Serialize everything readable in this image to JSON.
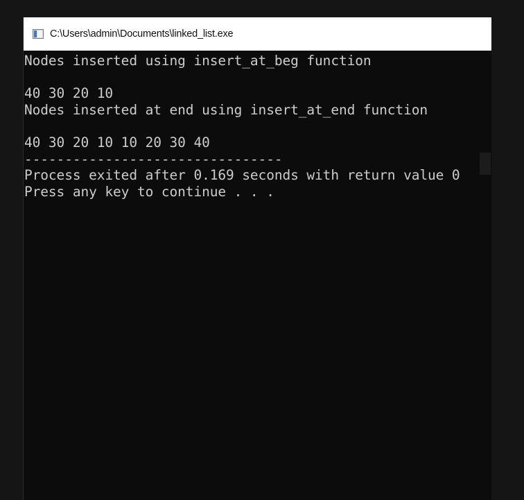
{
  "window": {
    "title": "C:\\Users\\admin\\Documents\\linked_list.exe",
    "icon": "console-app-icon"
  },
  "console": {
    "lines": [
      "Nodes inserted using insert_at_beg function",
      "",
      "40 30 20 10",
      "Nodes inserted at end using insert_at_end function",
      "",
      "40 30 20 10 10 20 30 40",
      "--------------------------------",
      "Process exited after 0.169 seconds with return value 0",
      "Press any key to continue . . ."
    ]
  },
  "colors": {
    "background": "#151515",
    "console_background": "#0c0c0c",
    "console_text": "#cccccc",
    "title_bar": "#ffffff"
  }
}
